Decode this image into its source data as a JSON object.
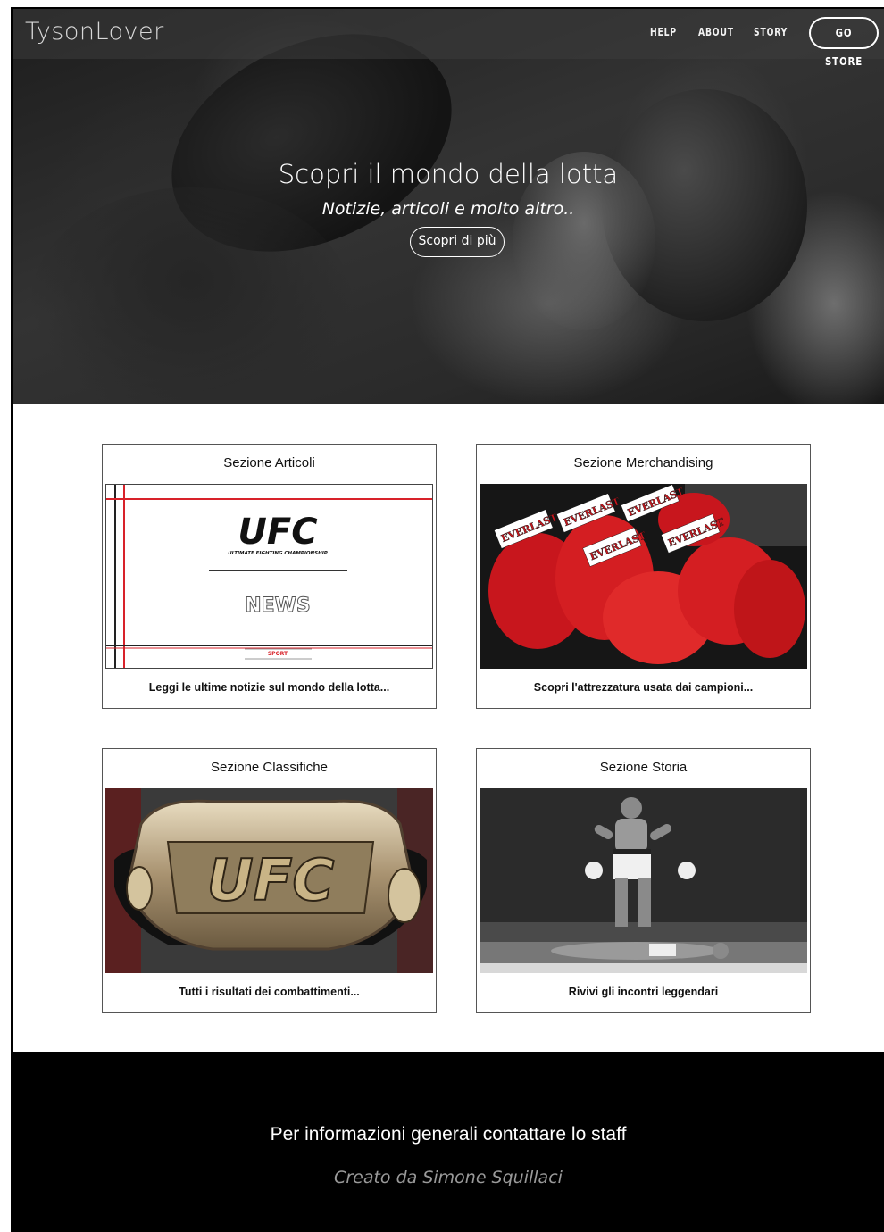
{
  "header": {
    "logo": "TysonLover",
    "nav": [
      {
        "label": "HELP"
      },
      {
        "label": "ABOUT"
      },
      {
        "label": "STORY"
      }
    ],
    "store_label": "GO STORE"
  },
  "hero": {
    "title": "Scopri il mondo della lotta",
    "subtitle": "Notizie, articoli e molto altro..",
    "button": "Scopri di più"
  },
  "cards": [
    {
      "title": "Sezione Articoli",
      "caption": "Leggi le ultime notizie sul mondo della lotta...",
      "img_text": {
        "brand": "UFC",
        "tagline": "ULTIMATE FIGHTING CHAMPIONSHIP",
        "headline": "NEWS",
        "footer": "SPORT"
      }
    },
    {
      "title": "Sezione Merchandising",
      "caption": "Scopri l'attrezzatura usata dai campioni...",
      "img_text": {
        "brand": "EVERLAST"
      }
    },
    {
      "title": "Sezione Classifiche",
      "caption": "Tutti i risultati dei combattimenti...",
      "img_text": {
        "brand": "UFC"
      }
    },
    {
      "title": "Sezione Storia",
      "caption": "Rivivi gli incontri leggendari"
    }
  ],
  "footer": {
    "main": "Per informazioni generali contattare lo staff",
    "credit": "Creato da Simone Squillaci"
  },
  "colors": {
    "footer_bg": "#000000",
    "accent_red": "#d8222a",
    "nav_text": "#ffffff"
  }
}
